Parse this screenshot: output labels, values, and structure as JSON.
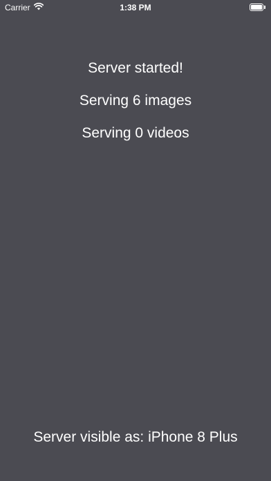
{
  "status_bar": {
    "carrier": "Carrier",
    "time": "1:38 PM",
    "icons": [
      "wifi-icon",
      "battery-icon"
    ]
  },
  "main": {
    "server_status": "Server started!",
    "images_line": "Serving 6 images",
    "videos_line": "Serving 0 videos"
  },
  "footer": {
    "visible_as": "Server visible as: iPhone 8 Plus"
  },
  "colors": {
    "background": "#4b4b52",
    "text": "#ffffff"
  }
}
